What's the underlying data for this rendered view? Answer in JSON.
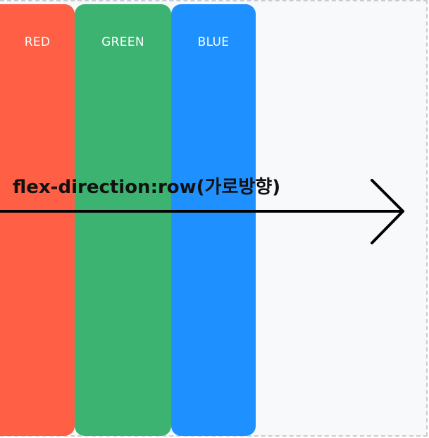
{
  "boxes": [
    {
      "label": "RED",
      "color": "#ff5f45"
    },
    {
      "label": "GREEN",
      "color": "#3cb371"
    },
    {
      "label": "BLUE",
      "color": "#1e90ff"
    }
  ],
  "caption": "flex-direction:row(가로방향)",
  "colors": {
    "background": "#f8f9fb",
    "border": "#c9ccd3",
    "arrow": "#000000"
  }
}
